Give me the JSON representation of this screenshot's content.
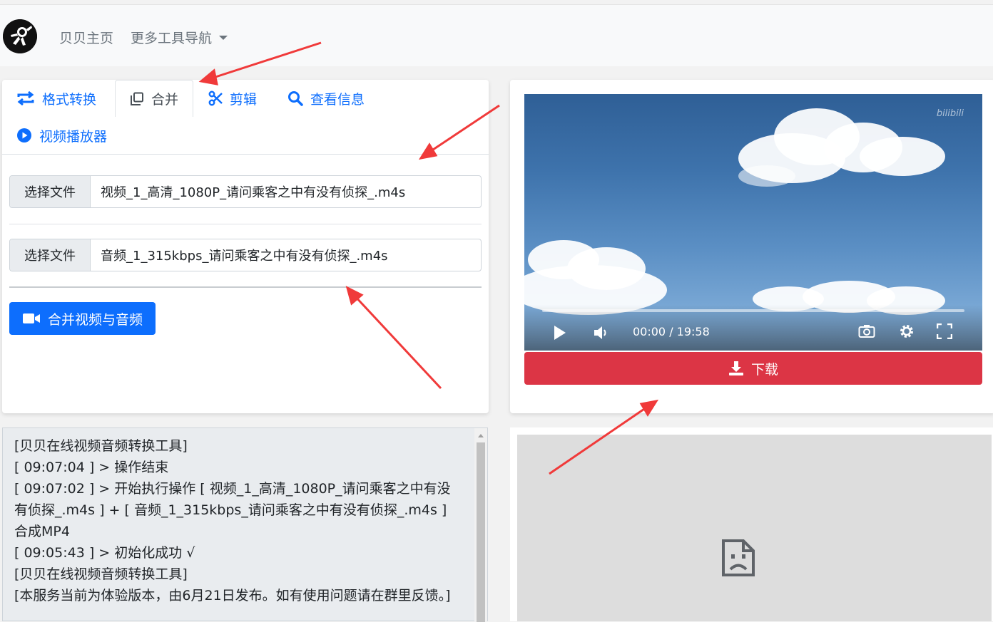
{
  "nav": {
    "home": "贝贝主页",
    "more_tools": "更多工具导航"
  },
  "tabs": [
    {
      "label": "格式转换",
      "icon": "convert-icon"
    },
    {
      "label": "合并",
      "icon": "copy-icon",
      "active": true
    },
    {
      "label": "剪辑",
      "icon": "scissors-icon"
    },
    {
      "label": "查看信息",
      "icon": "search-icon"
    },
    {
      "label": "视频播放器",
      "icon": "play-circle-icon"
    }
  ],
  "files": {
    "choose_label": "选择文件",
    "video_file": "视频_1_高清_1080P_请问乘客之中有没有侦探_.m4s",
    "audio_file": "音频_1_315kbps_请问乘客之中有没有侦探_.m4s"
  },
  "merge_button": "合并视频与音频",
  "player": {
    "time": "00:00 / 19:58",
    "progress": 0,
    "watermark": "bilibili"
  },
  "download_button": "下载",
  "log": {
    "lines": [
      "[贝贝在线视频音频转换工具]",
      "[ 09:07:04 ] > 操作结束",
      "[ 09:07:02 ] > 开始执行操作 [ 视频_1_高清_1080P_请问乘客之中有没有侦探_.m4s ] + [ 音频_1_315kbps_请问乘客之中有没有侦探_.m4s ] 合成MP4",
      "[ 09:05:43 ] > 初始化成功 √",
      "[贝贝在线视频音频转换工具]",
      "[本服务当前为体验版本，由6月21日发布。如有使用问题请在群里反馈。]"
    ]
  },
  "colors": {
    "primary": "#0d6efd",
    "danger": "#dc3545",
    "arrow": "#f03a3a"
  }
}
